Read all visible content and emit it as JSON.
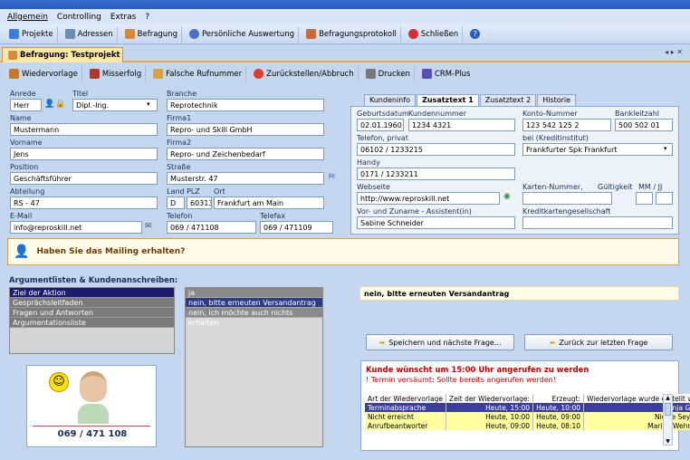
{
  "menu": [
    "Allgemein",
    "Controlling",
    "Extras",
    "?"
  ],
  "toolbar": [
    {
      "label": "Projekte",
      "icon": "projects-icon"
    },
    {
      "label": "Adressen",
      "icon": "address-book-icon"
    },
    {
      "label": "Befragung",
      "icon": "survey-icon"
    },
    {
      "label": "Persönliche Auswertung",
      "icon": "clock-icon"
    },
    {
      "label": "Befragungsprotokoll",
      "icon": "protocol-icon"
    },
    {
      "label": "Schließen",
      "icon": "close-icon"
    },
    {
      "label": "",
      "icon": "help-icon"
    }
  ],
  "active_tab": "Befragung: Testprojekt",
  "actions": [
    {
      "label": "Wiedervorlage",
      "icon": "resubmit-icon"
    },
    {
      "label": "Misserfolg",
      "icon": "failure-icon"
    },
    {
      "label": "Falsche Rufnummer",
      "icon": "wrong-number-icon"
    },
    {
      "label": "Zurückstellen/Abbruch",
      "icon": "cancel-icon"
    },
    {
      "label": "Drucken",
      "icon": "printer-icon"
    },
    {
      "label": "CRM-Plus",
      "icon": "crm-icon"
    }
  ],
  "contact": {
    "anrede_label": "Anrede",
    "anrede": "Herr",
    "titel_label": "Titel",
    "titel": "Dipl.-Ing.",
    "name_label": "Name",
    "name": "Mustermann",
    "vorname_label": "Vorname",
    "vorname": "Jens",
    "position_label": "Position",
    "position": "Geschäftsführer",
    "abteilung_label": "Abteilung",
    "abteilung": "RS - 47",
    "email_label": "E-Mail",
    "email": "info@reproskill.net",
    "branche_label": "Branche",
    "branche": "Reprotechnik",
    "firma1_label": "Firma1",
    "firma1": "Repro- und Skill GmbH",
    "firma2_label": "Firma2",
    "firma2": "Repro- und Zeichenbedarf",
    "strasse_label": "Straße",
    "strasse": "Musterstr. 47",
    "land_label": "Land",
    "land": "D",
    "plz_label": "PLZ",
    "plz": "60313",
    "ort_label": "Ort",
    "ort": "Frankfurt am Main",
    "telefon_label": "Telefon",
    "telefon": "069 / 471108",
    "telefax_label": "Telefax",
    "telefax": "069 / 471109"
  },
  "detail_tabs": [
    "Kundeninfo",
    "Zusatztext 1",
    "Zusatztext 2",
    "Historie"
  ],
  "detail": {
    "geburtsdatum_label": "Geburtsdatum",
    "geburtsdatum": "02.01.1960",
    "kundennummer_label": "Kundennummer",
    "kundennummer": "1234 4321",
    "kontonummer_label": "Konto-Nummer",
    "kontonummer": "123 542 125 2",
    "bankleitzahl_label": "Bankleitzahl",
    "bankleitzahl": "500 502 01",
    "telefon_privat_label": "Telefon, privat",
    "telefon_privat": "06102 / 1233215",
    "bank_label": "bei (Kreditinstitut)",
    "bank": "Frankfurter Spk Frankfurt",
    "handy_label": "Handy",
    "handy": "0171 / 1233211",
    "webseite_label": "Webseite",
    "webseite": "http://www.reproskill.net",
    "karten_label": "Karten-Nummer,",
    "gueltigkeit_label": "Gültigkeit",
    "mmjj_label": "MM / JJ",
    "assistent_label": "Vor- und Zuname - Assistent(in)",
    "assistent": "Sabine Schneider",
    "kartengesellschaft_label": "Kreditkartengesellschaft"
  },
  "question": "Haben Sie das Mailing erhalten?",
  "argument_title": "Argumentlisten & Kundenanschreiben:",
  "argument_items": [
    "Ziel der Aktion",
    "Gesprächsleitfaden",
    "Fragen und Antworten",
    "Argumentationsliste"
  ],
  "answers": [
    "ja",
    "nein, bitte erneuten Versandantrag",
    "nein, ich möchte auch nichts erhalten"
  ],
  "selected_answer": "nein, bitte erneuten Versandantrag",
  "buttons": {
    "save_next": "Speichern und nächste Frage...",
    "back": "Zurück zur letzten Frage"
  },
  "agent_phone": "069 / 471 108",
  "callback": {
    "title": "Kunde wünscht um 15:00 Uhr angerufen zu werden",
    "warning": "! Termin versäumt: Sollte bereits angerufen werden!",
    "headers": [
      "Art der Wiedervorlage",
      "Zeit der Wiedervorlage:",
      "Erzeugt:",
      "Wiedervorlage wurde erstellt von:"
    ],
    "rows": [
      [
        "Terminabsprache",
        "Heute, 15:00",
        "Heute, 10:00",
        "Anja Guse"
      ],
      [
        "Nicht erreicht",
        "Heute, 10:00",
        "Heute, 09:00",
        "Nicole Seyfert"
      ],
      [
        "Anrufbeantworter",
        "Heute, 09:00",
        "Heute, 08:10",
        "Marina Wehrlich"
      ]
    ]
  },
  "colors": {
    "accent": "#f2a43a",
    "selected_row": "#3d3d9c",
    "highlight_row": "#ffffa0",
    "warning": "#cc0000"
  }
}
